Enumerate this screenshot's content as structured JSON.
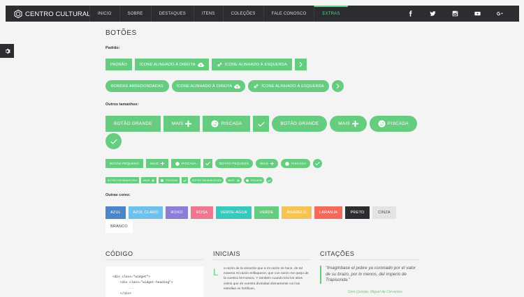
{
  "brand": {
    "name": "CENTRO CULTURAL"
  },
  "nav": {
    "items": [
      "INICIO",
      "SOBRE",
      "DESTAQUES",
      "ITENS",
      "COLEÇÕES",
      "FALE CONOSCO",
      "EXTRAS"
    ],
    "active_index": 6
  },
  "social": [
    "facebook-icon",
    "twitter-icon",
    "instagram-icon",
    "youtube-icon",
    "google-plus-icon"
  ],
  "page": {
    "title": "BOTÕES"
  },
  "sections": {
    "standard": "Padrão:",
    "sizes": "Outros tamanhos:",
    "colors": "Outras cores:"
  },
  "standard_buttons": {
    "default": "PADRÃO",
    "icon_right": "ÍCONE ALINHADO À DIREITA",
    "icon_left": "ÍCONE ALINHADO À ESQUERDA",
    "rounded": "BORDAS ARREDONDADAS"
  },
  "size_buttons": {
    "large": "BOTÃO GRANDE",
    "more": "MAIS",
    "blink": "PISCADA",
    "small": "BOTÃO PEQUENO",
    "mini": "BOTÃO EM MINIATURA"
  },
  "color_buttons": [
    {
      "label": "AZUL",
      "color": "#4a86c8",
      "text": "#ffffff"
    },
    {
      "label": "AZUL CLARO",
      "color": "#6fc1ec",
      "text": "#ffffff"
    },
    {
      "label": "ROXO",
      "color": "#8a7ed6",
      "text": "#ffffff"
    },
    {
      "label": "ROSA",
      "color": "#f0778f",
      "text": "#ffffff"
    },
    {
      "label": "VERDE-ÁGUA",
      "color": "#36c9bd",
      "text": "#ffffff"
    },
    {
      "label": "VERDE",
      "color": "#66cc80",
      "text": "#ffffff"
    },
    {
      "label": "AMARELO",
      "color": "#f6c455",
      "text": "#ffffff"
    },
    {
      "label": "LARANJA",
      "color": "#f46a5a",
      "text": "#ffffff"
    },
    {
      "label": "PRETO",
      "color": "#2b2d31",
      "text": "#ffffff"
    },
    {
      "label": "CINZA",
      "color": "#e3e3e3",
      "text": "#444444"
    },
    {
      "label": "BRANCO",
      "color": "#ffffff",
      "text": "#444444"
    }
  ],
  "bottom": {
    "code_title": "CÓDIGO",
    "code_text": "<div class=\"widget\">\n    <div class=\"widget-heading\">\n        ...\n    </div>\n    <div class=\"widget-content\">",
    "initials_title": "INICIAIS",
    "dropcap": "L",
    "initials_text": "a razón de la sinrazón que a mi razón se hace, de tal manera mi razón enflaquece, que con razón me quejo de la vuestra fermosura. Y también cuando leía los altos cielos que de vuestra divinidad divinamente con las estrellas os fortifican,",
    "quotes_title": "CITAÇÕES",
    "quote_text": "\"Imagínbase el pobre ya coronado por el valor de su brazo, por lo menos, del imperio de Trapisonda.\"",
    "quote_source": "Dom Quixote, Miguel de Cervantes"
  },
  "colors": {
    "accent": "#66cc80",
    "nav_bg": "#2b2d31",
    "page_bg": "#f4f4f4"
  }
}
